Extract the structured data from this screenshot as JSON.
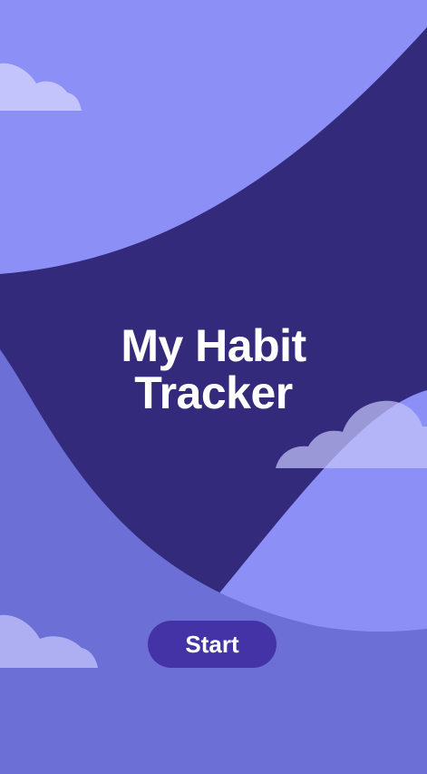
{
  "screen": {
    "title_line1": "My Habit",
    "title_line2": "Tracker",
    "start_label": "Start"
  },
  "colors": {
    "sky_light": "#8c8ff5",
    "deep_valley": "#332a7c",
    "hill_left": "#6b6fd6",
    "hill_right": "#8c8ff5",
    "cloud": "#c3c4fb",
    "button": "#4333a6",
    "text": "#ffffff"
  }
}
